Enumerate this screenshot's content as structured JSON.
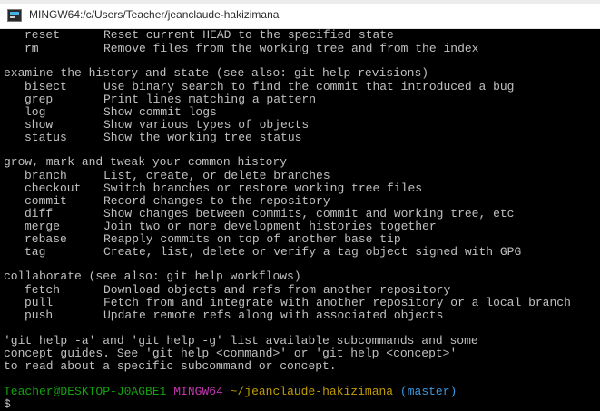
{
  "window": {
    "title": "MINGW64:/c/Users/Teacher/jeanclaude-hakizimana"
  },
  "sections": [
    {
      "heading": "",
      "commands": [
        {
          "name": "reset",
          "desc": "Reset current HEAD to the specified state"
        },
        {
          "name": "rm",
          "desc": "Remove files from the working tree and from the index"
        }
      ]
    },
    {
      "heading": "examine the history and state (see also: git help revisions)",
      "commands": [
        {
          "name": "bisect",
          "desc": "Use binary search to find the commit that introduced a bug"
        },
        {
          "name": "grep",
          "desc": "Print lines matching a pattern"
        },
        {
          "name": "log",
          "desc": "Show commit logs"
        },
        {
          "name": "show",
          "desc": "Show various types of objects"
        },
        {
          "name": "status",
          "desc": "Show the working tree status"
        }
      ]
    },
    {
      "heading": "grow, mark and tweak your common history",
      "commands": [
        {
          "name": "branch",
          "desc": "List, create, or delete branches"
        },
        {
          "name": "checkout",
          "desc": "Switch branches or restore working tree files"
        },
        {
          "name": "commit",
          "desc": "Record changes to the repository"
        },
        {
          "name": "diff",
          "desc": "Show changes between commits, commit and working tree, etc"
        },
        {
          "name": "merge",
          "desc": "Join two or more development histories together"
        },
        {
          "name": "rebase",
          "desc": "Reapply commits on top of another base tip"
        },
        {
          "name": "tag",
          "desc": "Create, list, delete or verify a tag object signed with GPG"
        }
      ]
    },
    {
      "heading": "collaborate (see also: git help workflows)",
      "commands": [
        {
          "name": "fetch",
          "desc": "Download objects and refs from another repository"
        },
        {
          "name": "pull",
          "desc": "Fetch from and integrate with another repository or a local branch"
        },
        {
          "name": "push",
          "desc": "Update remote refs along with associated objects"
        }
      ]
    }
  ],
  "footer": [
    "'git help -a' and 'git help -g' list available subcommands and some",
    "concept guides. See 'git help <command>' or 'git help <concept>'",
    "to read about a specific subcommand or concept."
  ],
  "prompt": {
    "user_host": "Teacher@DESKTOP-J0AGBE1",
    "system": "MINGW64",
    "path": "~/jeanclaude-hakizimana",
    "branch": "(master)",
    "symbol": "$"
  },
  "colors": {
    "terminal_bg": "#000000",
    "text": "#c0c0c0",
    "prompt_user": "#13a10e",
    "prompt_system": "#c239b3",
    "prompt_path": "#c19c00",
    "prompt_branch": "#3a96dd"
  },
  "icons": {
    "app": "git-bash-icon"
  }
}
